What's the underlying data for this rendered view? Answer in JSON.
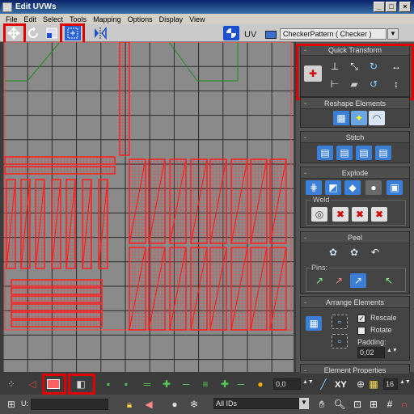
{
  "window": {
    "title": "Edit UVWs",
    "min": "_",
    "max": "□",
    "close": "×"
  },
  "menu": [
    "File",
    "Edit",
    "Select",
    "Tools",
    "Mapping",
    "Options",
    "Display",
    "View"
  ],
  "toolbar": {
    "uv_label": "UV",
    "map_select": "CheckerPattern  ( Checker )"
  },
  "panel": {
    "quick_transform": "Quick Transform",
    "reshape": "Reshape Elements",
    "stitch": "Stitch",
    "explode": "Explode",
    "weld": "Weld",
    "peel": "Peel",
    "pins": "Pins:",
    "arrange": "Arrange Elements",
    "rescale": "Rescale",
    "rotate": "Rotate",
    "padding_label": "Padding:",
    "padding_value": "0,02",
    "element_props": "Element Properties",
    "rollout_dash": "-"
  },
  "bottom": {
    "spinner_value": "0,0",
    "xy_label": "XY",
    "grid_value": "16",
    "u_label": "U:",
    "ids_select": "All IDs"
  },
  "colors": {
    "accent_red": "#e00000",
    "uv_red": "#ff2020",
    "uv_green": "#1c8c1c"
  }
}
